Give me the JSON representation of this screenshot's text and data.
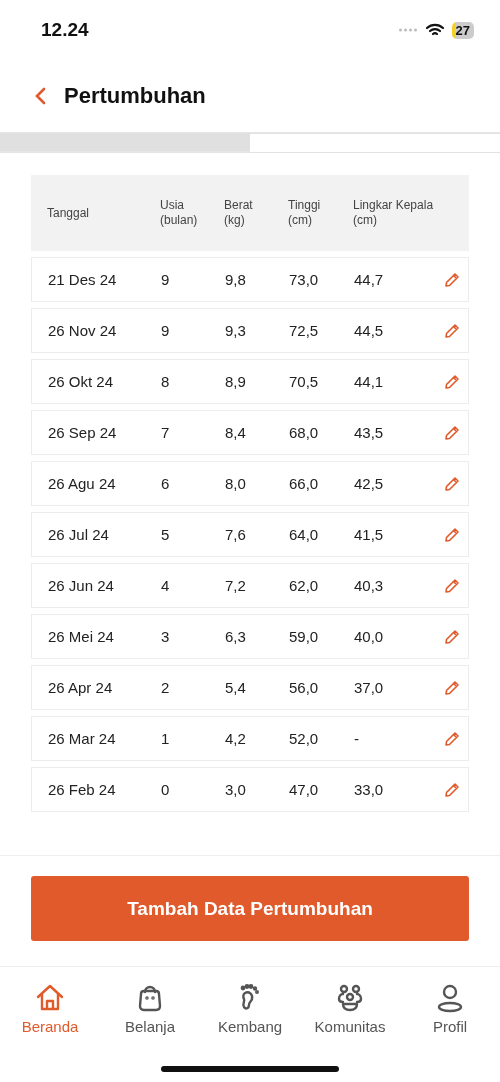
{
  "status_bar": {
    "time": "12.24",
    "battery": "27"
  },
  "header": {
    "title": "Pertumbuhan"
  },
  "tabs": [
    {
      "selected": false
    },
    {
      "selected": true
    }
  ],
  "table": {
    "columns": [
      "Tanggal",
      "Usia\n(bulan)",
      "Berat\n(kg)",
      "Tinggi\n(cm)",
      "Lingkar Kepala\n(cm)"
    ],
    "rows": [
      {
        "cells": [
          "21 Des 24",
          "9",
          "9,8",
          "73,0",
          "44,7"
        ]
      },
      {
        "cells": [
          "26 Nov 24",
          "9",
          "9,3",
          "72,5",
          "44,5"
        ]
      },
      {
        "cells": [
          "26 Okt 24",
          "8",
          "8,9",
          "70,5",
          "44,1"
        ]
      },
      {
        "cells": [
          "26 Sep 24",
          "7",
          "8,4",
          "68,0",
          "43,5"
        ]
      },
      {
        "cells": [
          "26 Agu 24",
          "6",
          "8,0",
          "66,0",
          "42,5"
        ]
      },
      {
        "cells": [
          "26 Jul 24",
          "5",
          "7,6",
          "64,0",
          "41,5"
        ]
      },
      {
        "cells": [
          "26 Jun 24",
          "4",
          "7,2",
          "62,0",
          "40,3"
        ]
      },
      {
        "cells": [
          "26 Mei 24",
          "3",
          "6,3",
          "59,0",
          "40,0"
        ]
      },
      {
        "cells": [
          "26 Apr 24",
          "2",
          "5,4",
          "56,0",
          "37,0"
        ]
      },
      {
        "cells": [
          "26 Mar 24",
          "1",
          "4,2",
          "52,0",
          "-"
        ]
      },
      {
        "cells": [
          "26 Feb 24",
          "0",
          "3,0",
          "47,0",
          "33,0"
        ]
      }
    ]
  },
  "add_button": "Tambah Data Pertumbuhan",
  "nav": [
    {
      "kind": "home",
      "label": "Beranda",
      "selected": true
    },
    {
      "kind": "bag",
      "label": "Belanja",
      "selected": false
    },
    {
      "kind": "foot",
      "label": "Kembang",
      "selected": false
    },
    {
      "kind": "people",
      "label": "Komunitas",
      "selected": false
    },
    {
      "kind": "user",
      "label": "Profil",
      "selected": false
    }
  ]
}
